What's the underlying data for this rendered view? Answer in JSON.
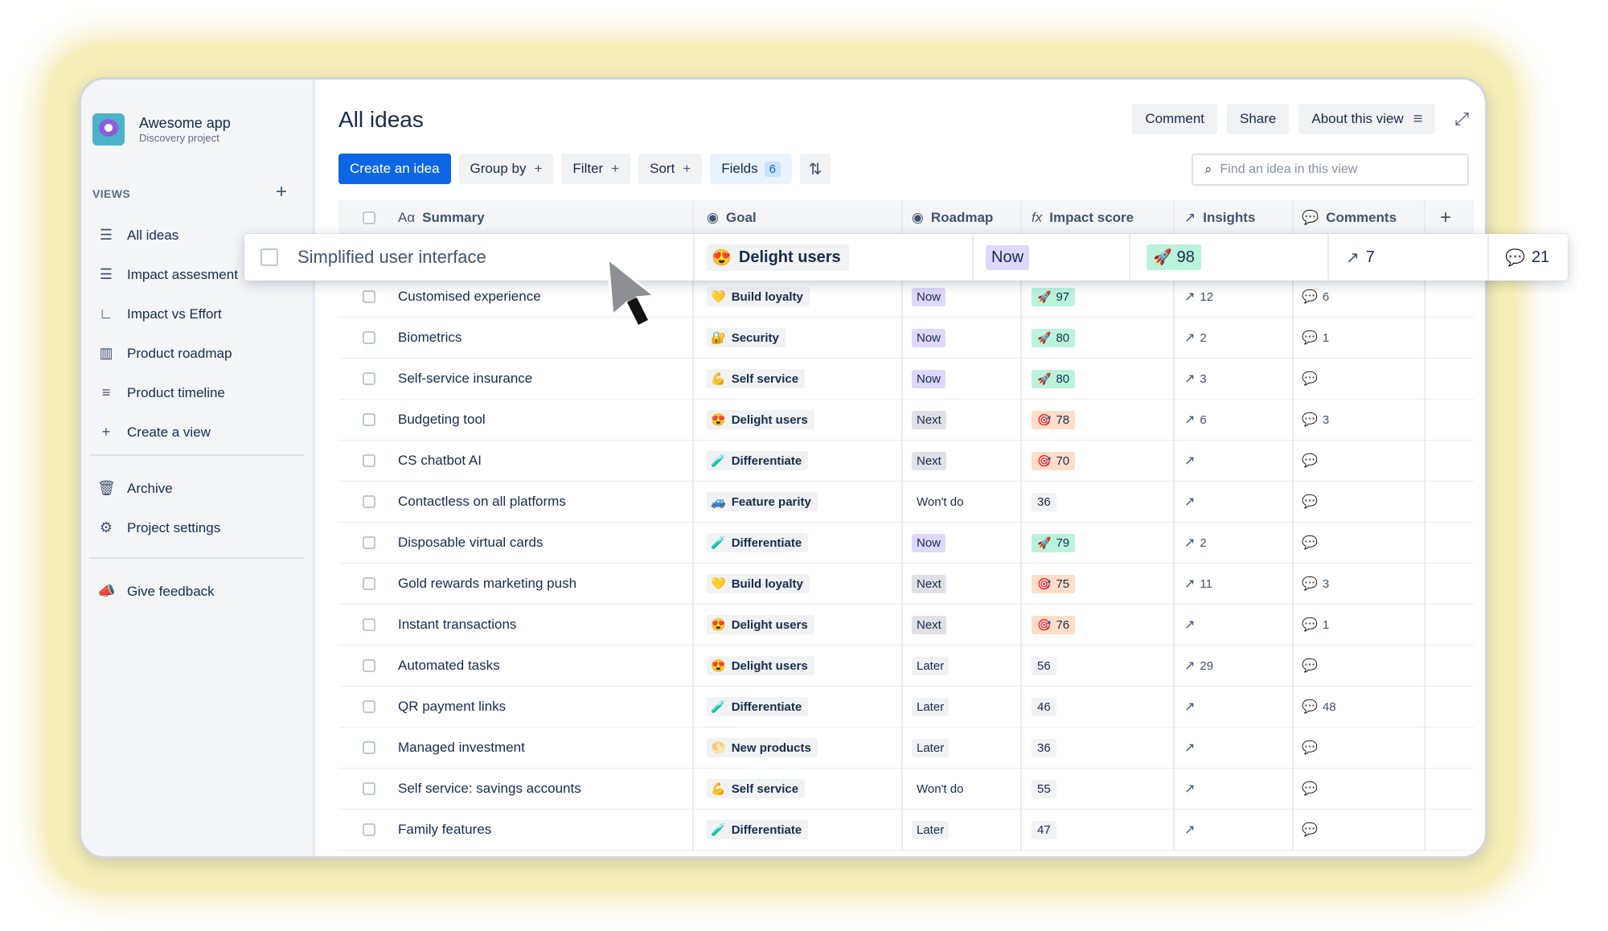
{
  "app": {
    "name": "Awesome app",
    "subtitle": "Discovery project"
  },
  "sidebar": {
    "views_label": "VIEWS",
    "items": [
      {
        "label": "All ideas",
        "icon": "list-icon"
      },
      {
        "label": "Impact assesment",
        "icon": "list-icon"
      },
      {
        "label": "Impact vs Effort",
        "icon": "matrix-icon"
      },
      {
        "label": "Product roadmap",
        "icon": "board-icon"
      },
      {
        "label": "Product timeline",
        "icon": "timeline-icon"
      },
      {
        "label": "Create a view",
        "icon": "plus-icon"
      }
    ],
    "archive": "Archive",
    "project_settings": "Project settings",
    "give_feedback": "Give feedback"
  },
  "header": {
    "title": "All ideas",
    "comment": "Comment",
    "share": "Share",
    "about": "About this view"
  },
  "toolbar": {
    "create": "Create an idea",
    "group_by": "Group by",
    "filter": "Filter",
    "sort": "Sort",
    "fields": "Fields",
    "fields_count": "6",
    "search_placeholder": "Find an idea in this view"
  },
  "columns": {
    "summary": "Summary",
    "goal": "Goal",
    "roadmap": "Roadmap",
    "impact": "Impact score",
    "insights": "Insights",
    "comments": "Comments"
  },
  "highlight_row": {
    "summary": "Simplified user interface",
    "goal": "Delight users",
    "goal_emoji": "😍",
    "roadmap": "Now",
    "impact_emoji": "🚀",
    "impact": "98",
    "insights": "7",
    "comments": "21"
  },
  "rows": [
    {
      "summary": "Customised experience",
      "goal": "Build loyalty",
      "goal_emoji": "💛",
      "roadmap": "Now",
      "impact": "97",
      "impact_emoji": "🚀",
      "impact_level": "high",
      "insights": "12",
      "comments": "6"
    },
    {
      "summary": "Biometrics",
      "goal": "Security",
      "goal_emoji": "🔐",
      "roadmap": "Now",
      "impact": "80",
      "impact_emoji": "🚀",
      "impact_level": "high",
      "insights": "2",
      "comments": "1"
    },
    {
      "summary": "Self-service insurance",
      "goal": "Self service",
      "goal_emoji": "💪",
      "roadmap": "Now",
      "impact": "80",
      "impact_emoji": "🚀",
      "impact_level": "high",
      "insights": "3",
      "comments": ""
    },
    {
      "summary": "Budgeting tool",
      "goal": "Delight users",
      "goal_emoji": "😍",
      "roadmap": "Next",
      "impact": "78",
      "impact_emoji": "🎯",
      "impact_level": "mid",
      "insights": "6",
      "comments": "3"
    },
    {
      "summary": "CS chatbot AI",
      "goal": "Differentiate",
      "goal_emoji": "🧪",
      "roadmap": "Next",
      "impact": "70",
      "impact_emoji": "🎯",
      "impact_level": "mid",
      "insights": "",
      "comments": ""
    },
    {
      "summary": "Contactless on all platforms",
      "goal": "Feature parity",
      "goal_emoji": "🚙",
      "roadmap": "Won't do",
      "impact": "36",
      "impact_emoji": "",
      "impact_level": "low",
      "insights": "",
      "comments": ""
    },
    {
      "summary": "Disposable virtual cards",
      "goal": "Differentiate",
      "goal_emoji": "🧪",
      "roadmap": "Now",
      "impact": "79",
      "impact_emoji": "🚀",
      "impact_level": "high",
      "insights": "2",
      "comments": ""
    },
    {
      "summary": "Gold rewards marketing push",
      "goal": "Build loyalty",
      "goal_emoji": "💛",
      "roadmap": "Next",
      "impact": "75",
      "impact_emoji": "🎯",
      "impact_level": "mid",
      "insights": "11",
      "comments": "3"
    },
    {
      "summary": "Instant transactions",
      "goal": "Delight users",
      "goal_emoji": "😍",
      "roadmap": "Next",
      "impact": "76",
      "impact_emoji": "🎯",
      "impact_level": "mid",
      "insights": "",
      "comments": "1"
    },
    {
      "summary": "Automated tasks",
      "goal": "Delight users",
      "goal_emoji": "😍",
      "roadmap": "Later",
      "impact": "56",
      "impact_emoji": "",
      "impact_level": "low",
      "insights": "29",
      "comments": ""
    },
    {
      "summary": "QR payment links",
      "goal": "Differentiate",
      "goal_emoji": "🧪",
      "roadmap": "Later",
      "impact": "46",
      "impact_emoji": "",
      "impact_level": "low",
      "insights": "",
      "comments": "48"
    },
    {
      "summary": "Managed investment",
      "goal": "New products",
      "goal_emoji": "🌕",
      "roadmap": "Later",
      "impact": "36",
      "impact_emoji": "",
      "impact_level": "low",
      "insights": "",
      "comments": ""
    },
    {
      "summary": "Self service: savings accounts",
      "goal": "Self service",
      "goal_emoji": "💪",
      "roadmap": "Won't do",
      "impact": "55",
      "impact_emoji": "",
      "impact_level": "low",
      "insights": "",
      "comments": ""
    },
    {
      "summary": "Family features",
      "goal": "Differentiate",
      "goal_emoji": "🧪",
      "roadmap": "Later",
      "impact": "47",
      "impact_emoji": "",
      "impact_level": "low",
      "insights": "",
      "comments": ""
    }
  ],
  "colors": {
    "accent": "#0c66e4",
    "roadmap_now": "#dfd8fd",
    "roadmap_next": "#dfe1e6",
    "impact_high": "#baf3db",
    "impact_mid": "#fedec8",
    "frame_glow": "#f6efb8"
  }
}
